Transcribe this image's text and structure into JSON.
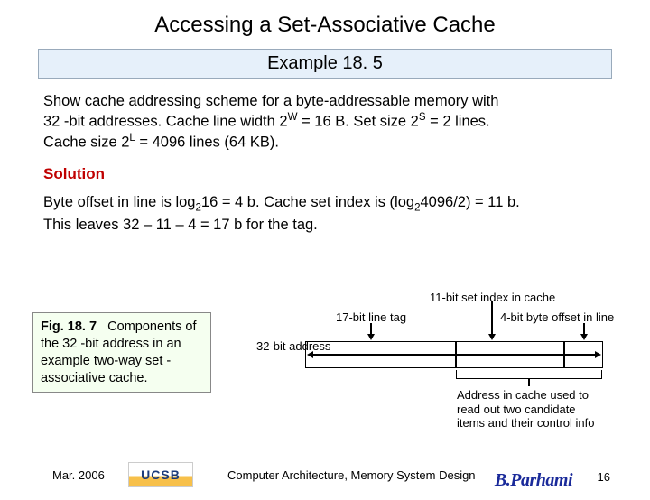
{
  "title": "Accessing a Set-Associative Cache",
  "example_label": "Example 18. 5",
  "problem": {
    "l1": "Show cache addressing scheme for a byte-addressable memory with",
    "l2a": "32 -bit addresses. Cache line width 2",
    "l2b": " = 16 B. Set size 2",
    "l2c": " = 2 lines.",
    "l3a": "Cache size 2",
    "l3b": " = 4096 lines (64 KB).",
    "supW": "W",
    "supS": "S",
    "supL": "L"
  },
  "solution_heading": "Solution",
  "solution": {
    "l1a": "Byte offset in line is log",
    "l1b": "16 = 4 b. Cache set index is (log",
    "l1c": "4096/2) = 11 b.",
    "l2": "This leaves 32 – 11 – 4 = 17 b for the tag.",
    "sub2": "2"
  },
  "figure": {
    "num": "Fig. 18. 7",
    "caption": "Components of the 32 -bit address in an example two-way set -associative cache."
  },
  "diagram": {
    "set_index_label": "11-bit set index in cache",
    "tag_label": "17-bit line tag",
    "offset_label": "4-bit byte offset in line",
    "addr_label": "32-bit address",
    "readout_l1": "Address in cache used to",
    "readout_l2": "read out two candidate",
    "readout_l3": "items and their control info"
  },
  "footer": {
    "date": "Mar. 2006",
    "logo": "UCSB",
    "center": "Computer Architecture, Memory System Design",
    "signature": "B.Parhami",
    "page": "16"
  }
}
